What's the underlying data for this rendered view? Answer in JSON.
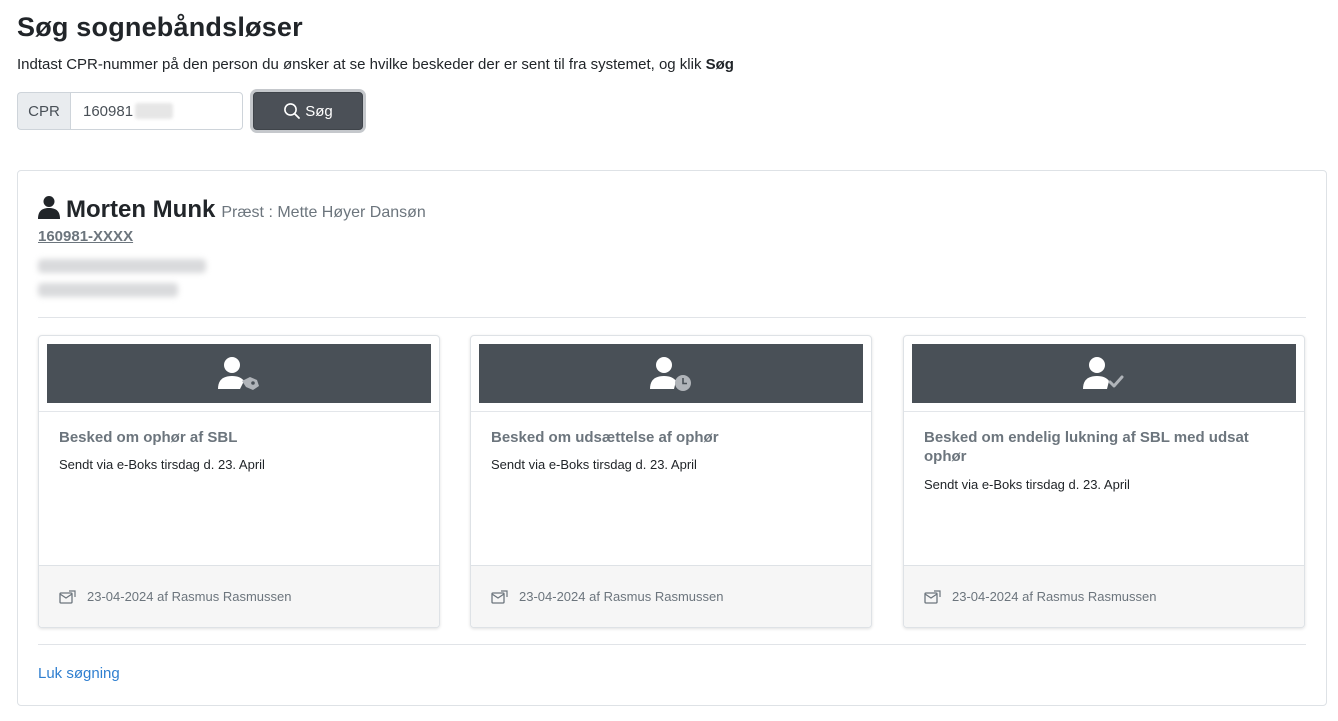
{
  "header": {
    "title": "Søg sognebåndsløser",
    "intro_text": "Indtast CPR-nummer på den person du ønsker at se hvilke beskeder der er sent til fra systemet, og klik ",
    "intro_bold": "Søg"
  },
  "search": {
    "prefix": "CPR",
    "value": "160981",
    "button_label": "Søg",
    "button_icon": "search-icon"
  },
  "person": {
    "icon": "user-icon",
    "name": "Morten Munk",
    "role": "Præst : Mette Høyer Dansøn",
    "cpr": "160981-XXXX"
  },
  "cards": [
    {
      "icon": "user-tag-icon",
      "title": "Besked om ophør af SBL",
      "text": "Sendt via e-Boks tirsdag d. 23. April",
      "footer_icon": "mail-sent-icon",
      "footer": "23-04-2024 af Rasmus Rasmussen"
    },
    {
      "icon": "user-clock-icon",
      "title": "Besked om udsættelse af ophør",
      "text": "Sendt via e-Boks tirsdag d. 23. April",
      "footer_icon": "mail-sent-icon",
      "footer": "23-04-2024 af Rasmus Rasmussen"
    },
    {
      "icon": "user-check-icon",
      "title": "Besked om endelig lukning af SBL med udsat ophør",
      "text": "Sendt via e-Boks tirsdag d. 23. April",
      "footer_icon": "mail-sent-icon",
      "footer": "23-04-2024 af Rasmus Rasmussen"
    }
  ],
  "close_link": "Luk søgning",
  "colors": {
    "dark": "#495057",
    "muted": "#6c757d",
    "link": "#2f7fd0"
  }
}
